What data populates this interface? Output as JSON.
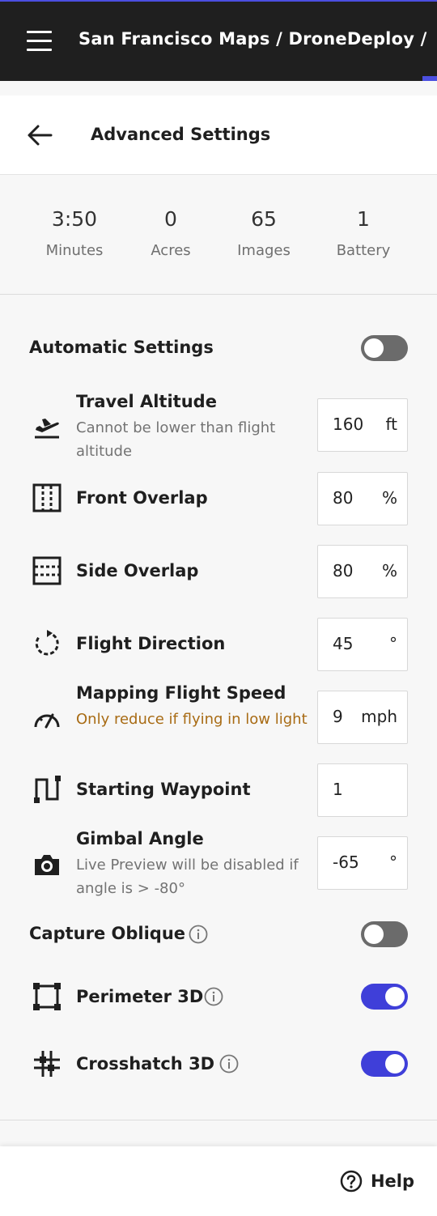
{
  "topbar": {
    "breadcrumb": "San Francisco Maps / DroneDeploy /",
    "accent_color": "#4b4fe0"
  },
  "header": {
    "title": "Advanced Settings"
  },
  "stats": [
    {
      "value": "3:50",
      "label": "Minutes"
    },
    {
      "value": "0",
      "label": "Acres"
    },
    {
      "value": "65",
      "label": "Images"
    },
    {
      "value": "1",
      "label": "Battery"
    }
  ],
  "automatic": {
    "label": "Automatic Settings",
    "enabled": false
  },
  "settings": {
    "travel_altitude": {
      "label": "Travel Altitude",
      "sub": "Cannot be lower than flight altitude",
      "value": "160",
      "unit": "ft"
    },
    "front_overlap": {
      "label": "Front Overlap",
      "value": "80",
      "unit": "%"
    },
    "side_overlap": {
      "label": "Side Overlap",
      "value": "80",
      "unit": "%"
    },
    "flight_direction": {
      "label": "Flight Direction",
      "value": "45",
      "unit": "°"
    },
    "mapping_speed": {
      "label": "Mapping Flight Speed",
      "sub": "Only reduce if flying in low light",
      "value": "9",
      "unit": "mph"
    },
    "starting_waypoint": {
      "label": "Starting Waypoint",
      "value": "1"
    },
    "gimbal_angle": {
      "label": "Gimbal Angle",
      "sub": "Live Preview will be disabled if angle is > -80°",
      "value": "-65",
      "unit": "°"
    }
  },
  "capture_oblique": {
    "label": "Capture Oblique",
    "enabled": false
  },
  "perimeter_3d": {
    "label": "Perimeter 3D",
    "enabled": true
  },
  "crosshatch_3d": {
    "label": "Crosshatch 3D",
    "enabled": true
  },
  "footer": {
    "help_label": "Help"
  },
  "colors": {
    "toggle_on": "#3f3fd9",
    "toggle_off": "#6b6b6b",
    "warning_text": "#a86b14"
  }
}
